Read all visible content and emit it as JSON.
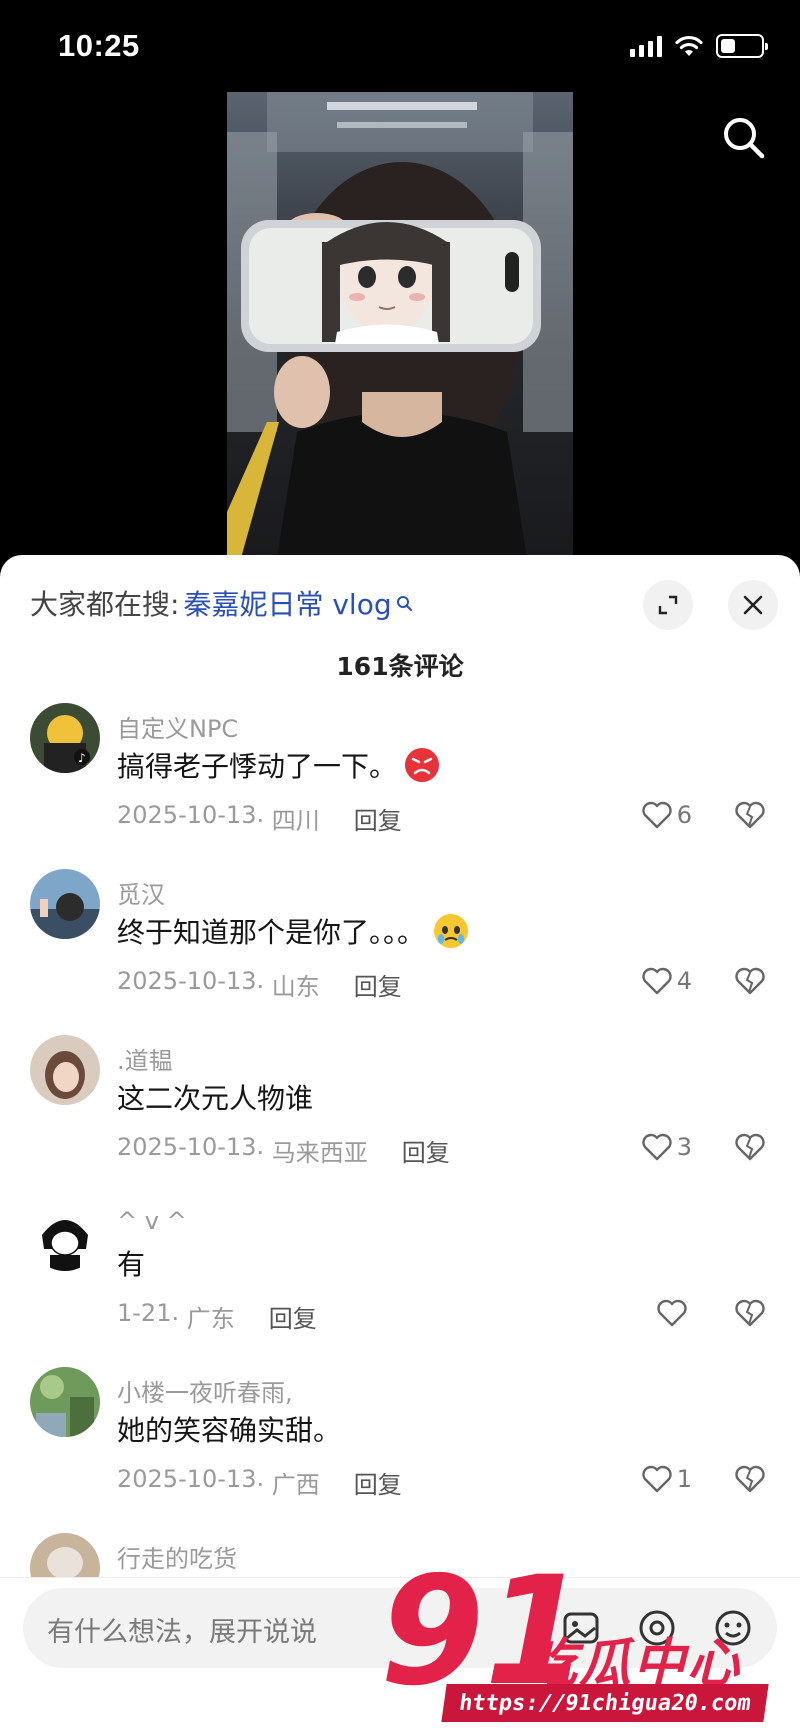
{
  "status_bar": {
    "time": "10:25",
    "battery_percent": 25
  },
  "search_hint": {
    "prefix": "大家都在搜:",
    "keyword": "秦嘉妮日常 vlog"
  },
  "comment_count": "161条评论",
  "comments": [
    {
      "name": "自定义NPC",
      "text": "搞得老子悸动了一下。",
      "date": "2025-10-13",
      "location": "· 四川",
      "reply": "回复",
      "likes": "6",
      "emoji": "angry-face-emoji"
    },
    {
      "name": "觅汉",
      "text": "终于知道那个是你了。。。",
      "date": "2025-10-13",
      "location": "· 山东",
      "reply": "回复",
      "likes": "4",
      "emoji": "teary-face-emoji"
    },
    {
      "name": ".道韫",
      "text": "这二次元人物谁",
      "date": "2025-10-13",
      "location": "· 马来西亚",
      "reply": "回复",
      "likes": "3"
    },
    {
      "name": "^ v ^",
      "text": "有",
      "date": "1-21",
      "location": "· 广东",
      "reply": "回复",
      "likes": ""
    },
    {
      "name": "小楼一夜听春雨,",
      "text": "她的笑容确实甜。",
      "date": "2025-10-13",
      "location": "· 广西",
      "reply": "回复",
      "likes": "1"
    },
    {
      "name": "行走的吃货"
    }
  ],
  "input": {
    "placeholder": "有什么想法，展开说说"
  },
  "watermark": {
    "number": "91",
    "text": "吃瓜中心",
    "url": "https://91chigua20.com"
  },
  "colors": {
    "accent_link": "#2a4fb5",
    "watermark_red": "#e3224a"
  }
}
